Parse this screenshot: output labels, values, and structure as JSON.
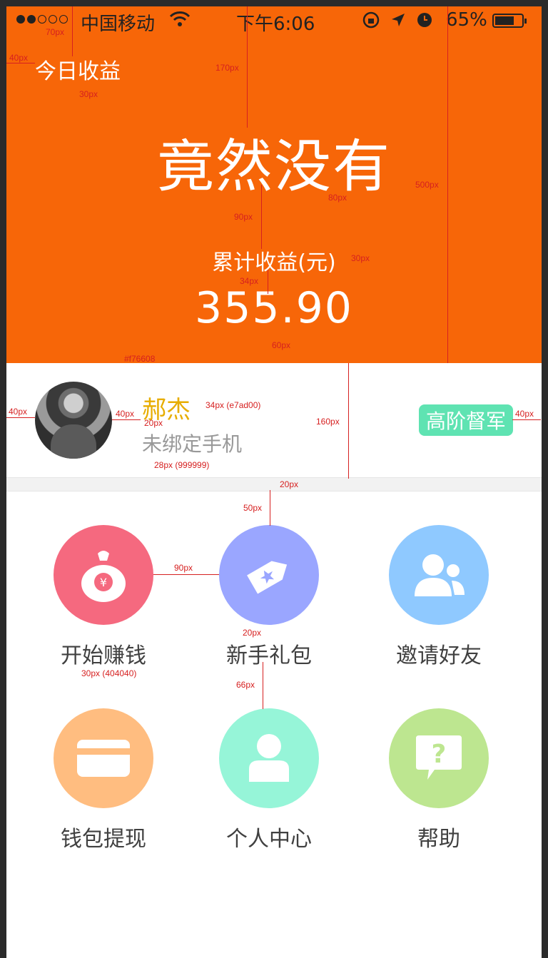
{
  "status": {
    "carrier": "中国移动",
    "time": "下午6:06",
    "battery_pct": "65%"
  },
  "header": {
    "today_label": "今日收益",
    "today_value": "竟然没有",
    "cumulative_label": "累计收益(元)",
    "cumulative_value": "355.90"
  },
  "profile": {
    "name": "郝杰",
    "phone_status": "未绑定手机",
    "rank": "高阶督军"
  },
  "menu": [
    {
      "label": "开始赚钱",
      "icon": "money-bag-icon",
      "color": "#f5697f"
    },
    {
      "label": "新手礼包",
      "icon": "gift-tag-icon",
      "color": "#9aa6ff"
    },
    {
      "label": "邀请好友",
      "icon": "friends-icon",
      "color": "#8fc9ff"
    },
    {
      "label": "钱包提现",
      "icon": "card-icon",
      "color": "#ffbd80"
    },
    {
      "label": "个人中心",
      "icon": "person-icon",
      "color": "#96f5d8"
    },
    {
      "label": "帮助",
      "icon": "help-icon",
      "color": "#bde690"
    }
  ],
  "annotations": {
    "a70": "70px",
    "a40": "40px",
    "a30": "30px",
    "a170": "170px",
    "a500": "500px",
    "a80": "80px",
    "a90": "90px",
    "a30b": "30px",
    "a34": "34px",
    "a60": "60px",
    "color_bg": "#f76608",
    "a160": "160px",
    "a40b": "40px",
    "a40c": "40px",
    "a20a": "20px",
    "name_spec": "34px (e7ad00)",
    "phone_spec": "28px (999999)",
    "a40d": "40px",
    "a20b": "20px",
    "a50": "50px",
    "a90b": "90px",
    "a20c": "20px",
    "label_spec": "30px (404040)",
    "a66": "66px"
  }
}
